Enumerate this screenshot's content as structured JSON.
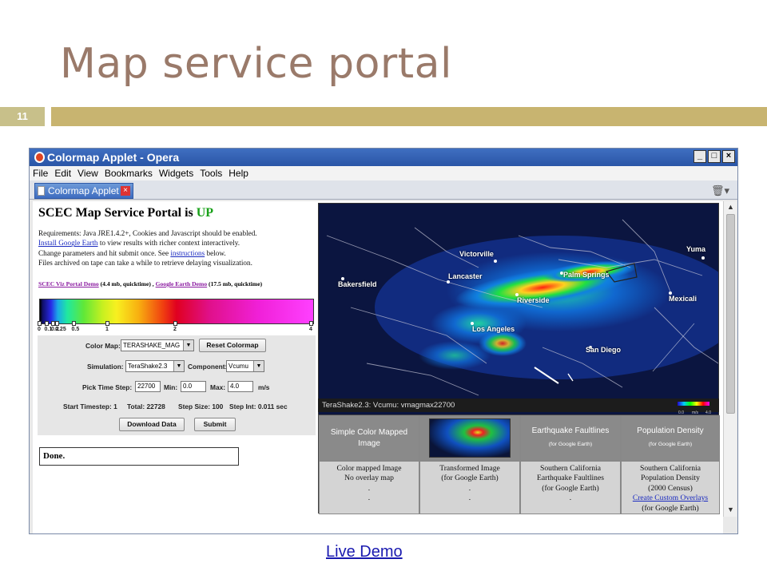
{
  "slide": {
    "title": "Map service portal",
    "number": "11",
    "footer_link": "Live Demo"
  },
  "browser": {
    "window_title": "Colormap Applet - Opera",
    "menu": [
      "File",
      "Edit",
      "View",
      "Bookmarks",
      "Widgets",
      "Tools",
      "Help"
    ],
    "tab_label": "Colormap Applet",
    "controls": {
      "minimize": "_",
      "maximize": "□",
      "close": "×"
    }
  },
  "portal": {
    "heading": "SCEC Map Service Portal is ",
    "status": "UP",
    "req_line1": "Requirements: Java JRE1.4.2+, Cookies and Javascript should be enabled.",
    "req_link_install": "Install Google Earth",
    "req_line2_rest": " to view results with richer context interactively.",
    "req_line3_pre": "Change parameters and hit submit once. See ",
    "req_link_instructions": "instructions",
    "req_line3_post": " below.",
    "req_line4": "Files archived on tape can take a while to retrieve delaying visualization.",
    "demo_link1": "SCEC Viz Portal Demo",
    "demo_link1_size": " (4.4 mb, quicktime) , ",
    "demo_link2": "Google Earth Demo",
    "demo_link2_size": " (17.5 mb, quicktime)",
    "colorbar_ticks": [
      "0",
      "0.1",
      "0.2",
      "0.25",
      "0.5",
      "1",
      "2",
      "4"
    ],
    "colorbar_ticks_fraction": [
      0.0,
      0.025,
      0.05,
      0.065,
      0.125,
      0.25,
      0.5,
      1.0
    ],
    "color_map_label": "Color Map:",
    "color_map_value": "TERASHAKE_MAG",
    "reset_button": "Reset Colormap",
    "simulation_label": "Simulation:",
    "simulation_value": "TeraShake2.3",
    "component_label": "Component:",
    "component_value": "Vcumu",
    "pick_label": "Pick Time Step:",
    "pick_value": "22700",
    "min_label": "Min:",
    "min_value": "0.0",
    "max_label": "Max:",
    "max_value": "4.0",
    "unit": "m/s",
    "start_timestep": "Start Timestep: 1",
    "total": "Total: 22728",
    "step_size": "Step Size: 100",
    "step_int": "Step Int: 0.011 sec",
    "download_button": "Download Data",
    "submit_button": "Submit",
    "status_box": "Done."
  },
  "map": {
    "caption": "TeraShake2.3: Vcumu: vmagmax22700",
    "legend_min": "0.0",
    "legend_unit": "m/s",
    "legend_max": "4.0",
    "cities": [
      "Victorville",
      "Yuma",
      "Bakersfield",
      "Lancaster",
      "Palm Springs",
      "Riverside",
      "Mexicali",
      "Los Angeles",
      "San Diego"
    ]
  },
  "table": {
    "headers": [
      {
        "title": "Simple Color Mapped Image",
        "sub": ""
      },
      {
        "title": "",
        "sub": ""
      },
      {
        "title": "Earthquake Faultlines",
        "sub": "(for Google Earth)"
      },
      {
        "title": "Population Density",
        "sub": "(for Google Earth)"
      }
    ],
    "cells": [
      {
        "line1": "Color mapped Image",
        "line2": "No overlay map",
        "line3": "",
        "line4": ""
      },
      {
        "line1": "Transformed Image",
        "line2": "(for Google Earth)",
        "line3": "",
        "line4": ""
      },
      {
        "line1": "Southern California",
        "line2": "Earthquake Faultlines",
        "line3": "(for Google Earth)",
        "line4": ""
      },
      {
        "line1": "Southern California",
        "line2": "Population Density",
        "line3": "(2000 Census)",
        "link": "Create Custom Overlays",
        "line5": "(for Google Earth)"
      }
    ]
  },
  "colors": {
    "title": "#9a7a6a",
    "accent_bar": "#c8b470",
    "status_up": "#18a018",
    "link": "#1a2ac0"
  }
}
